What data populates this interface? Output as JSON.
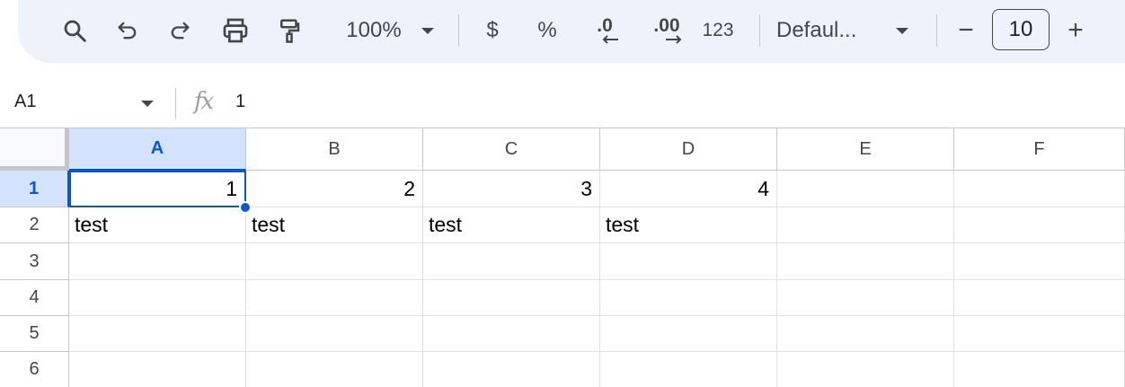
{
  "toolbar": {
    "zoom": "100%",
    "currency_label": "$",
    "percent_label": "%",
    "decrease_decimal_label": ".0",
    "increase_decimal_label": ".00",
    "number_format_label": "123",
    "font_name": "Defaul...",
    "font_size": "10",
    "decrease_font_label": "−",
    "increase_font_label": "+"
  },
  "formula_bar": {
    "name_box": "A1",
    "fx_label": "fx",
    "value": "1"
  },
  "grid": {
    "columns": [
      "A",
      "B",
      "C",
      "D",
      "E",
      "F"
    ],
    "rows": [
      "1",
      "2",
      "3",
      "4",
      "5",
      "6"
    ],
    "active_column": "A",
    "active_row": "1",
    "cells": [
      [
        "1",
        "2",
        "3",
        "4",
        "",
        ""
      ],
      [
        "test",
        "test",
        "test",
        "test",
        "",
        ""
      ],
      [
        "",
        "",
        "",
        "",
        "",
        ""
      ],
      [
        "",
        "",
        "",
        "",
        "",
        ""
      ],
      [
        "",
        "",
        "",
        "",
        "",
        ""
      ],
      [
        "",
        "",
        "",
        "",
        "",
        ""
      ]
    ]
  },
  "colors": {
    "accent": "#0b57d0",
    "header_highlight": "#d3e3fd",
    "toolbar_bg": "#eef3fb"
  }
}
